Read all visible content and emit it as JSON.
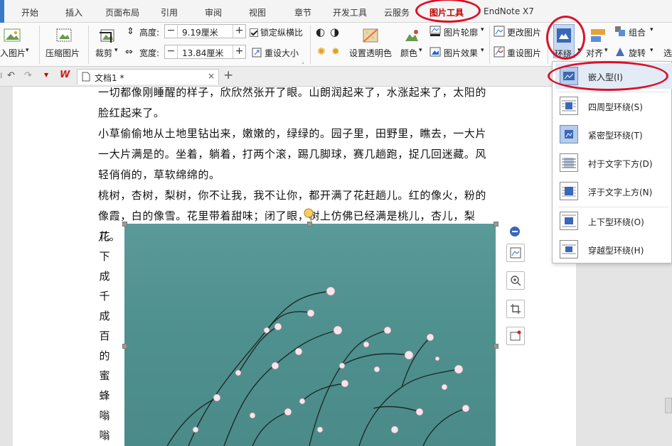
{
  "tabs": [
    "开始",
    "插入",
    "页面布局",
    "引用",
    "审阅",
    "视图",
    "章节",
    "开发工具",
    "云服务",
    "图片工具",
    "EndNote X7"
  ],
  "active_tab": "图片工具",
  "ribbon": {
    "insert_picture": "入图片",
    "compress_picture": "压缩图片",
    "crop": "裁剪",
    "height_label": "高度:",
    "height_value": "9.19厘米",
    "width_label": "宽度:",
    "width_value": "13.84厘米",
    "lock_ratio": "锁定纵横比",
    "reset_size": "重设大小",
    "set_transparent": "设置透明色",
    "color": "颜色",
    "picture_outline": "图片轮廓",
    "picture_effects": "图片效果",
    "change_picture": "更改图片",
    "reset_picture": "重设图片",
    "wrap": "环绕",
    "align": "对齐",
    "group": "组合",
    "rotate": "旋转",
    "select": "选"
  },
  "doc_tab": {
    "title": "文档1 *",
    "app_badge": "W"
  },
  "document": {
    "lines": [
      "一切都像刚睡醒的样子，欣欣然张开了眼。山朗润起来了，水涨起来了，太阳的",
      "脸红起来了。",
      "小草偷偷地从土地里钻出来，嫩嫩的，绿绿的。园子里，田野里，瞧去，一大片",
      "一大片满是的。坐着，躺着，打两个滚，踢几脚球，赛几趟跑，捉几回迷藏。风",
      "轻俏俏的，草软绵绵的。",
      "桃树，杏树，梨树，你不让我，我不让你，都开满了花赶趟儿。红的像火，粉的",
      "像霞，白的像雪。花里带着甜味；闭了眼，树上仿佛已经满是桃儿，杏儿，梨儿。"
    ],
    "vertical_chars": [
      "花",
      "下",
      "成",
      "千",
      "成",
      "百",
      "的",
      "蜜",
      "蜂",
      "嗡",
      "嗡"
    ]
  },
  "wrap_menu": [
    {
      "label": "嵌入型(I)",
      "icon": "inline-wrap-icon"
    },
    {
      "label": "四周型环绕(S)",
      "icon": "square-wrap-icon"
    },
    {
      "label": "紧密型环绕(T)",
      "icon": "tight-wrap-icon"
    },
    {
      "label": "衬于文字下方(D)",
      "icon": "behind-text-icon"
    },
    {
      "label": "浮于文字上方(N)",
      "icon": "front-text-icon"
    },
    {
      "label": "上下型环绕(O)",
      "icon": "topbottom-wrap-icon"
    },
    {
      "label": "穿越型环绕(H)",
      "icon": "through-wrap-icon"
    }
  ],
  "colors": {
    "accent": "#3c78c8",
    "annotation": "#d8132a",
    "active_tab_text": "#c00000",
    "photo_bg": "#4f918f"
  }
}
